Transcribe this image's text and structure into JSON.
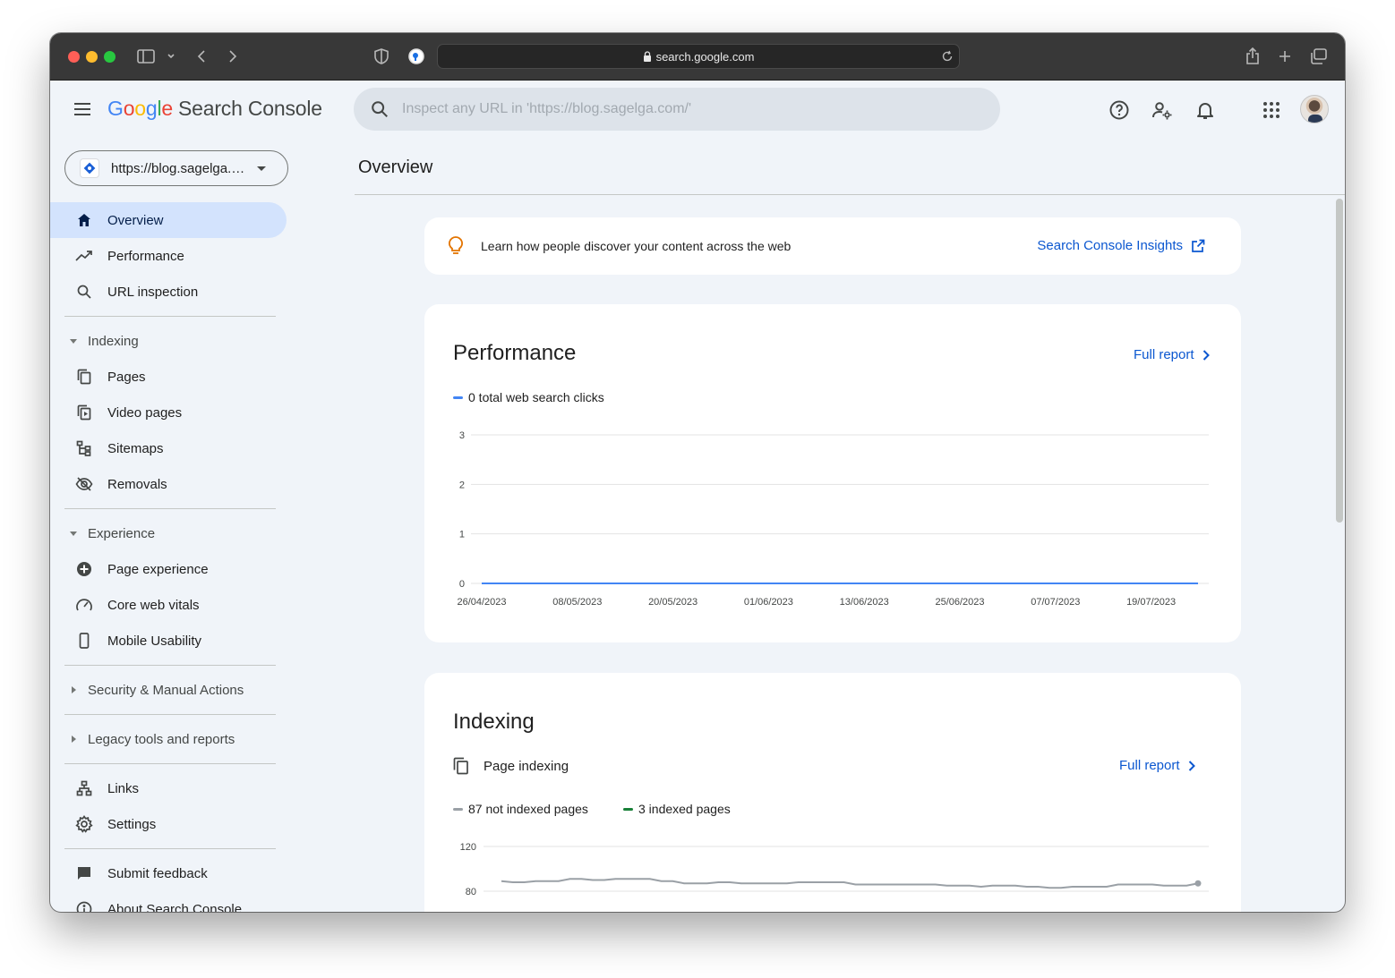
{
  "browser": {
    "url": "search.google.com"
  },
  "header": {
    "brand": "Google",
    "product": "Search Console",
    "search_placeholder": "Inspect any URL in 'https://blog.sagelga.com/'"
  },
  "sidebar": {
    "property": "https://blog.sagelga.com/",
    "items": [
      {
        "label": "Overview",
        "icon": "home-icon",
        "active": true
      },
      {
        "label": "Performance",
        "icon": "trending-up-icon"
      },
      {
        "label": "URL inspection",
        "icon": "search-icon"
      }
    ],
    "indexing": {
      "label": "Indexing",
      "items": [
        {
          "label": "Pages",
          "icon": "pages-icon"
        },
        {
          "label": "Video pages",
          "icon": "video-pages-icon"
        },
        {
          "label": "Sitemaps",
          "icon": "sitemap-icon"
        },
        {
          "label": "Removals",
          "icon": "eye-off-icon"
        }
      ]
    },
    "experience": {
      "label": "Experience",
      "items": [
        {
          "label": "Page experience",
          "icon": "plus-circle-icon"
        },
        {
          "label": "Core web vitals",
          "icon": "gauge-icon"
        },
        {
          "label": "Mobile Usability",
          "icon": "phone-icon"
        }
      ]
    },
    "security": {
      "label": "Security & Manual Actions"
    },
    "legacy": {
      "label": "Legacy tools and reports"
    },
    "bottom": [
      {
        "label": "Links",
        "icon": "links-icon"
      },
      {
        "label": "Settings",
        "icon": "gear-icon"
      }
    ],
    "footer": [
      {
        "label": "Submit feedback",
        "icon": "feedback-icon"
      },
      {
        "label": "About Search Console",
        "icon": "info-icon"
      }
    ]
  },
  "main": {
    "title": "Overview",
    "tip": {
      "text": "Learn how people discover your content across the web",
      "link": "Search Console Insights"
    },
    "performance": {
      "title": "Performance",
      "full_report": "Full report",
      "legend": "0 total web search clicks"
    },
    "indexing": {
      "title": "Indexing",
      "subtitle": "Page indexing",
      "full_report": "Full report",
      "legend_not_indexed": "87 not indexed pages",
      "legend_indexed": "3 indexed pages"
    }
  },
  "colors": {
    "accent": "#0b57d0",
    "clicks_series": "#4285f4",
    "not_indexed_series": "#9aa0a6",
    "indexed_series": "#188038",
    "active_nav": "#d3e3fd"
  },
  "chart_data": [
    {
      "type": "line",
      "series": [
        {
          "name": "0 total web search clicks",
          "values": [
            0,
            0,
            0,
            0,
            0,
            0,
            0,
            0
          ]
        }
      ],
      "x": [
        "26/04/2023",
        "08/05/2023",
        "20/05/2023",
        "01/06/2023",
        "13/06/2023",
        "25/06/2023",
        "07/07/2023",
        "19/07/2023"
      ],
      "yticks": [
        0,
        1,
        2,
        3
      ],
      "ylim": [
        0,
        3
      ],
      "grid": true
    },
    {
      "type": "line",
      "series": [
        {
          "name": "87 not indexed pages",
          "values": [
            89,
            88,
            88,
            89,
            89,
            89,
            91,
            91,
            90,
            90,
            91,
            91,
            91,
            91,
            89,
            89,
            87,
            87,
            87,
            88,
            88,
            87,
            87,
            87,
            87,
            87,
            88,
            88,
            88,
            88,
            88,
            86,
            86,
            86,
            86,
            86,
            86,
            86,
            86,
            85,
            85,
            85,
            84,
            85,
            85,
            85,
            84,
            84,
            83,
            83,
            84,
            84,
            84,
            84,
            86,
            86,
            86,
            86,
            85,
            85,
            85,
            87
          ]
        }
      ],
      "yticks": [
        80,
        120
      ],
      "ylim_visible": [
        80,
        120
      ],
      "grid": true
    }
  ]
}
